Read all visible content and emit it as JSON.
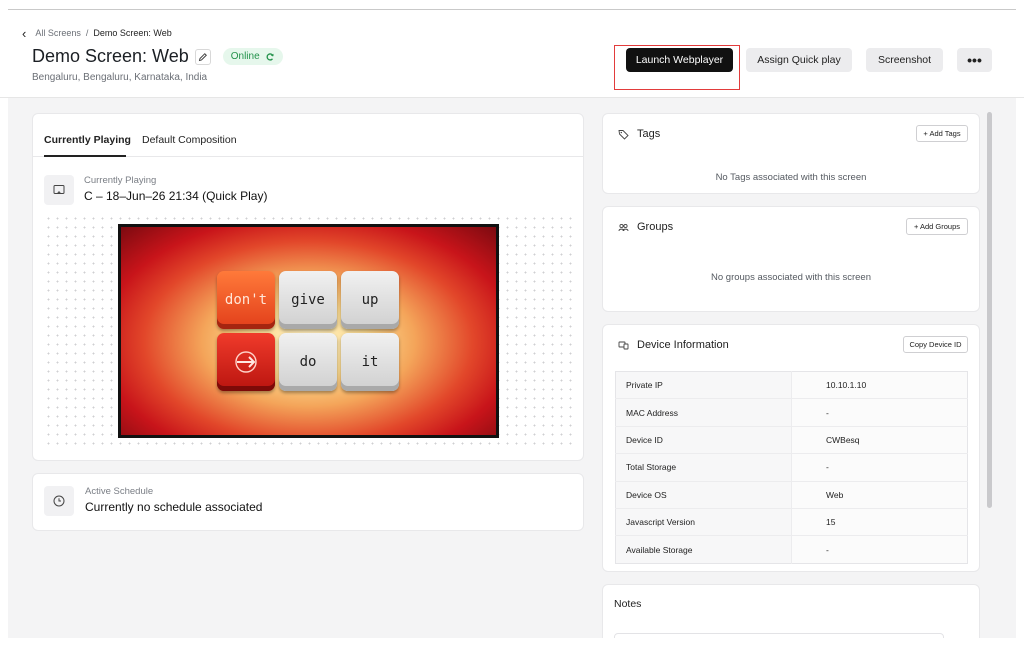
{
  "breadcrumb": {
    "root": "All Screens",
    "separator": "/",
    "current": "Demo Screen: Web"
  },
  "header": {
    "title": "Demo Screen: Web",
    "status": "Online",
    "location": "Bengaluru, Bengaluru, Karnataka, India"
  },
  "actions": {
    "launch": "Launch Webplayer",
    "quick_play": "Assign Quick play",
    "screenshot": "Screenshot",
    "more": "•••"
  },
  "playing": {
    "tabs": [
      "Currently Playing",
      "Default Composition"
    ],
    "label": "Currently Playing",
    "value": "C – 18–Jun–26 21:34  (Quick Play)",
    "keys": [
      "don't",
      "give",
      "up",
      "do",
      "it"
    ]
  },
  "schedule": {
    "label": "Active Schedule",
    "value": "Currently no schedule associated"
  },
  "tags": {
    "title": "Tags",
    "add": "+ Add Tags",
    "empty": "No Tags associated with this screen"
  },
  "groups": {
    "title": "Groups",
    "add": "+ Add Groups",
    "empty": "No groups associated with this screen"
  },
  "device": {
    "title": "Device Information",
    "copy": "Copy Device ID",
    "rows": [
      {
        "key": "Private IP",
        "value": "10.10.1.10"
      },
      {
        "key": "MAC Address",
        "value": "-"
      },
      {
        "key": "Device ID",
        "value": "CWBesq"
      },
      {
        "key": "Total Storage",
        "value": "-"
      },
      {
        "key": "Device OS",
        "value": "Web"
      },
      {
        "key": "Javascript Version",
        "value": "15"
      },
      {
        "key": "Available Storage",
        "value": "-"
      }
    ]
  },
  "notes": {
    "title": "Notes"
  },
  "colors": {
    "online_bg": "#e6f7ec",
    "online_text": "#23924b",
    "primary_btn": "#111111",
    "highlight": "#e23b3b"
  }
}
